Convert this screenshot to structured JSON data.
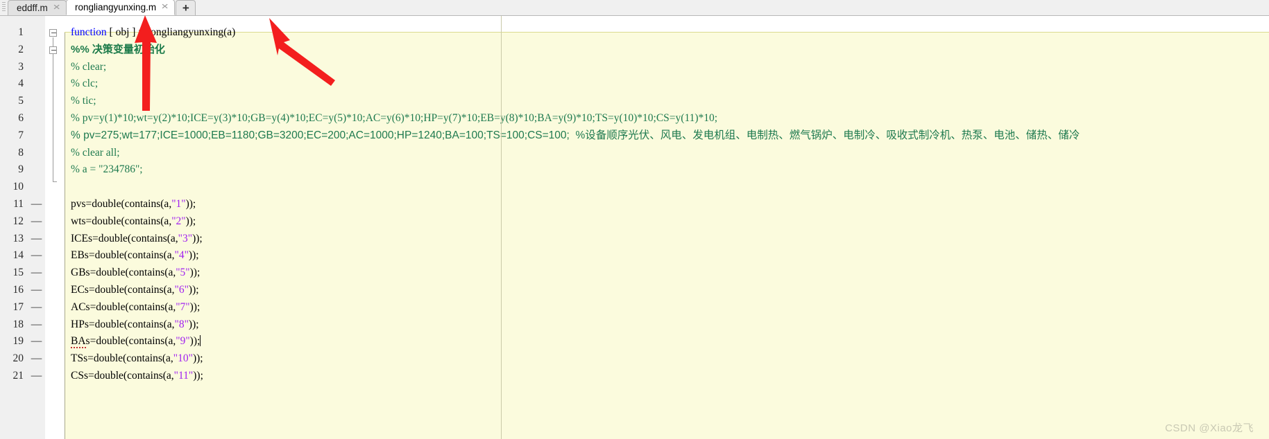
{
  "window": {
    "app": "MATLAB Editor",
    "watermark": "CSDN @Xiao龙飞"
  },
  "tabs": {
    "items": [
      {
        "label": "eddff.m",
        "active": false,
        "close": "✕"
      },
      {
        "label": "rongliangyunxing.m",
        "active": true,
        "close": "✕"
      }
    ],
    "add_label": "+"
  },
  "editor": {
    "language": "MATLAB",
    "colors": {
      "background": "#fbfbdd",
      "gutter": "#f0f0f0",
      "keyword": "#0000ff",
      "comment": "#1e7a4f",
      "string": "#a020f0",
      "text": "#000000",
      "annotation_arrow": "#ff0000"
    },
    "lines": [
      {
        "number": "1",
        "mark": "",
        "text": "function [ obj ] = rongliangyunxing(a)"
      },
      {
        "number": "2",
        "mark": "",
        "text": "%% 决策变量初始化"
      },
      {
        "number": "3",
        "mark": "",
        "text": "% clear;"
      },
      {
        "number": "4",
        "mark": "",
        "text": "% clc;"
      },
      {
        "number": "5",
        "mark": "",
        "text": "% tic;"
      },
      {
        "number": "6",
        "mark": "",
        "text": "% pv=y(1)*10;wt=y(2)*10;ICE=y(3)*10;GB=y(4)*10;EC=y(5)*10;AC=y(6)*10;HP=y(7)*10;EB=y(8)*10;BA=y(9)*10;TS=y(10)*10;CS=y(11)*10;"
      },
      {
        "number": "7",
        "mark": "",
        "text": "% pv=275;wt=177;ICE=1000;EB=1180;GB=3200;EC=200;AC=1000;HP=1240;BA=100;TS=100;CS=100;  %设备顺序光伏、风电、发电机组、电制热、燃气锅炉、电制冷、吸收式制冷机、热泵、电池、储热、储冷"
      },
      {
        "number": "8",
        "mark": "",
        "text": "% clear all;"
      },
      {
        "number": "9",
        "mark": "",
        "text": "% a = \"234786\";"
      },
      {
        "number": "10",
        "mark": "",
        "text": ""
      },
      {
        "number": "11",
        "mark": "—",
        "text": "pvs=double(contains(a,\"1\"));"
      },
      {
        "number": "12",
        "mark": "—",
        "text": "wts=double(contains(a,\"2\"));"
      },
      {
        "number": "13",
        "mark": "—",
        "text": "ICEs=double(contains(a,\"3\"));"
      },
      {
        "number": "14",
        "mark": "—",
        "text": "EBs=double(contains(a,\"4\"));"
      },
      {
        "number": "15",
        "mark": "—",
        "text": "GBs=double(contains(a,\"5\"));"
      },
      {
        "number": "16",
        "mark": "—",
        "text": "ECs=double(contains(a,\"6\"));"
      },
      {
        "number": "17",
        "mark": "—",
        "text": "ACs=double(contains(a,\"7\"));"
      },
      {
        "number": "18",
        "mark": "—",
        "text": "HPs=double(contains(a,\"8\"));"
      },
      {
        "number": "19",
        "mark": "—",
        "text": "BAs=double(contains(a,\"9\"));"
      },
      {
        "number": "20",
        "mark": "—",
        "text": "TSs=double(contains(a,\"10\"));"
      },
      {
        "number": "21",
        "mark": "—",
        "text": "CSs=double(contains(a,\"11\"));"
      }
    ]
  },
  "annotations": {
    "arrow_1_target": "obj",
    "arrow_2_target": "rongliangyunxing(a)"
  }
}
